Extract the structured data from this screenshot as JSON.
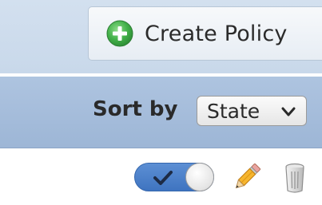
{
  "toolbar": {
    "create_policy_label": "Create Policy",
    "create_policy_icon": "plus-circle-icon",
    "accent_green": "#3aa34a"
  },
  "sort": {
    "label": "Sort by",
    "selected": "State"
  },
  "row_actions": {
    "toggle_state": "enabled",
    "toggle_icon": "check-icon",
    "edit_icon": "pencil-icon",
    "delete_icon": "trash-icon",
    "toggle_color": "#4a7fc8"
  }
}
